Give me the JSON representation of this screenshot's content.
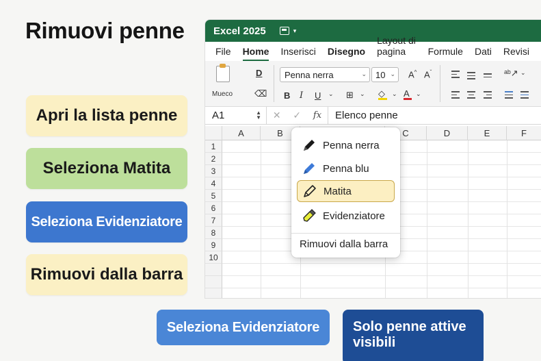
{
  "page_title": "Rimuovi penne",
  "steps": [
    {
      "label": "Apri la lista penne"
    },
    {
      "label": "Seleziona Matita"
    },
    {
      "label": "Seleziona Evidenziatore"
    },
    {
      "label": "Rimuovi dalla barra"
    }
  ],
  "bottom_buttons": {
    "select_highlighter": "Seleziona Evidenziatore",
    "only_active_pens": "Solo penne attive visibili"
  },
  "excel": {
    "app_name": "Excel 2025",
    "tabs": [
      "File",
      "Home",
      "Inserisci",
      "Disegno",
      "Layout di pagina",
      "Formule",
      "Dati",
      "Revisi"
    ],
    "active_tab": "Home",
    "clipboard_label": "Mueco",
    "font_name": "Penna nerra",
    "font_size": "10",
    "ribbon_glyphs": {
      "bold": "B",
      "italic": "I",
      "underline": "U",
      "grow": "A^",
      "shrink": "A˅",
      "wrap": "ab"
    },
    "name_box": "A1",
    "fx_label": "fx",
    "formula_value": "Elenco penne",
    "columns": [
      "A",
      "B",
      "C",
      "D",
      "E",
      "F"
    ],
    "rows": [
      "1",
      "2",
      "3",
      "4",
      "5",
      "6",
      "7",
      "8",
      "9",
      "10"
    ]
  },
  "pen_popup": {
    "items": [
      {
        "label": "Penna nerra",
        "icon": "black-pen-icon",
        "color": "#1a1a1a"
      },
      {
        "label": "Penna blu",
        "icon": "blue-pen-icon",
        "color": "#3d7ad8"
      },
      {
        "label": "Matita",
        "icon": "pencil-icon",
        "color": "#222222",
        "selected": true
      },
      {
        "label": "Evidenziatore",
        "icon": "highlighter-icon",
        "color": "#e8ee3a"
      }
    ],
    "remove_label": "Rimuovi dalla barra"
  },
  "colors": {
    "excel_green": "#1d6b41",
    "card_yellow": "#fbf0c4",
    "card_green": "#bddf9b",
    "card_blue": "#3d77cf",
    "button_blue": "#4a86d6",
    "button_navy": "#1e4d95"
  }
}
